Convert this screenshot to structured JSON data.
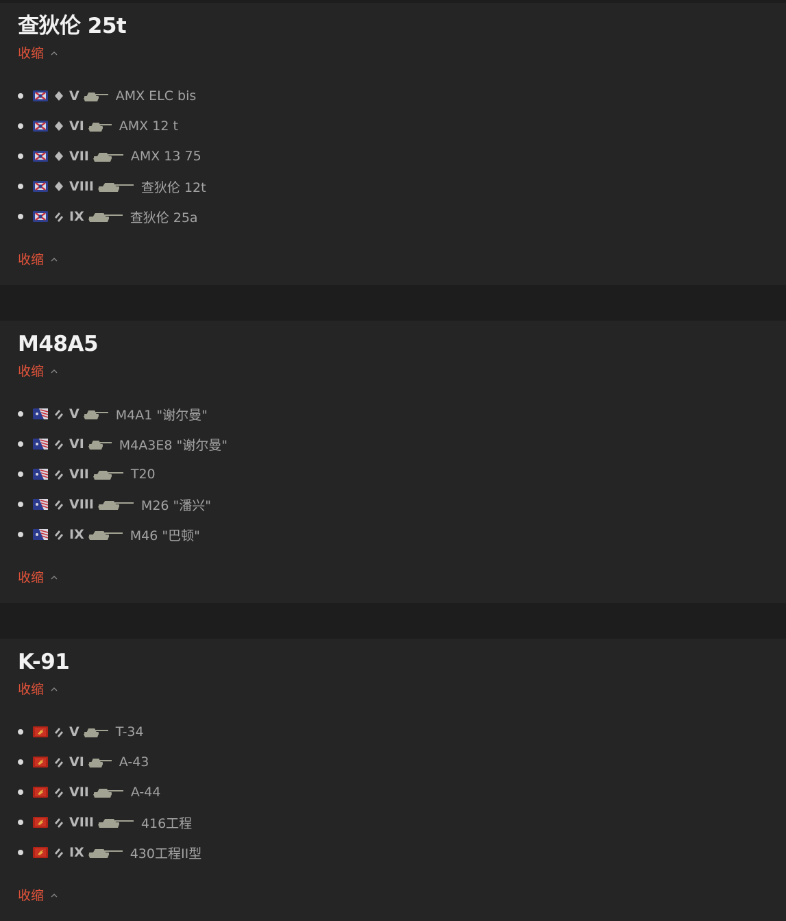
{
  "colors": {
    "page_bg": "#1d1d1d",
    "panel_bg": "#252525",
    "title": "#f2f2f2",
    "accent": "#e0533a",
    "text_muted": "#a3a3a3",
    "silhouette": "#a3a394"
  },
  "panels": [
    {
      "title": "查狄伦 25t",
      "collapse_top": "收缩",
      "collapse_bottom": "收缩",
      "nation": "france",
      "tanks": [
        {
          "tier": "V",
          "class_icon": "diamond-icon",
          "name": "AMX ELC bis"
        },
        {
          "tier": "VI",
          "class_icon": "diamond-icon",
          "name": "AMX 12 t"
        },
        {
          "tier": "VII",
          "class_icon": "diamond-icon",
          "name": "AMX 13 75"
        },
        {
          "tier": "VIII",
          "class_icon": "diamond-icon",
          "name": "查狄伦 12t"
        },
        {
          "tier": "IX",
          "class_icon": "medium-tank-icon",
          "name": "查狄伦 25a"
        }
      ]
    },
    {
      "title": "M48A5",
      "collapse_top": "收缩",
      "collapse_bottom": "收缩",
      "nation": "usa",
      "tanks": [
        {
          "tier": "V",
          "class_icon": "medium-tank-icon",
          "name": "M4A1 \"谢尔曼\""
        },
        {
          "tier": "VI",
          "class_icon": "medium-tank-icon",
          "name": "M4A3E8 \"谢尔曼\""
        },
        {
          "tier": "VII",
          "class_icon": "medium-tank-icon",
          "name": "T20"
        },
        {
          "tier": "VIII",
          "class_icon": "medium-tank-icon",
          "name": "M26 \"潘兴\""
        },
        {
          "tier": "IX",
          "class_icon": "medium-tank-icon",
          "name": "M46 \"巴顿\""
        }
      ]
    },
    {
      "title": "K-91",
      "collapse_top": "收缩",
      "collapse_bottom": "收缩",
      "nation": "ussr",
      "tanks": [
        {
          "tier": "V",
          "class_icon": "medium-tank-icon",
          "name": "T-34"
        },
        {
          "tier": "VI",
          "class_icon": "medium-tank-icon",
          "name": "A-43"
        },
        {
          "tier": "VII",
          "class_icon": "medium-tank-icon",
          "name": "A-44"
        },
        {
          "tier": "VIII",
          "class_icon": "medium-tank-icon",
          "name": "416工程"
        },
        {
          "tier": "IX",
          "class_icon": "medium-tank-icon",
          "name": "430工程II型"
        }
      ]
    }
  ]
}
